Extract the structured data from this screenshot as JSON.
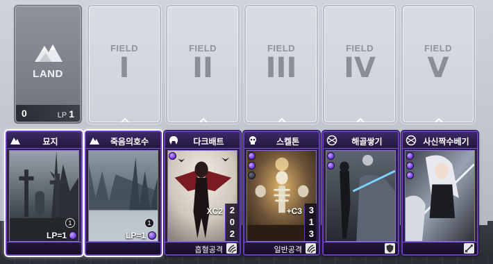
{
  "land": {
    "label": "LAND",
    "count": "0",
    "lp_label": "LP",
    "lp_value": "1"
  },
  "fields": [
    {
      "word": "FIELD",
      "numeral": "I"
    },
    {
      "word": "FIELD",
      "numeral": "II"
    },
    {
      "word": "FIELD",
      "numeral": "III"
    },
    {
      "word": "FIELD",
      "numeral": "IV"
    },
    {
      "word": "FIELD",
      "numeral": "V"
    }
  ],
  "cards": [
    {
      "name": "묘지",
      "cost": "1",
      "lp": "LP=1",
      "icon": "mountain-icon"
    },
    {
      "name": "죽음의호수",
      "cost": "1",
      "lp": "LP=1",
      "icon": "mountain-icon"
    },
    {
      "name": "다크배트",
      "multiplier": "XC2",
      "stats": [
        "2",
        "0",
        "2"
      ],
      "footer": "흡혈공격",
      "icon": "helmet-icon",
      "foot_icon": "claw-icon"
    },
    {
      "name": "스켈톤",
      "multiplier": "+C3",
      "stats": [
        "3",
        "1",
        "3"
      ],
      "footer": "일반공격",
      "icon": "skull-icon",
      "foot_icon": "claw-icon"
    },
    {
      "name": "해골쌓기",
      "icon": "rune-icon",
      "foot_icon": "shield-icon"
    },
    {
      "name": "사신짝수베기",
      "icon": "rune-icon",
      "foot_icon": "sword-icon"
    }
  ],
  "colors": {
    "card_border": "#6a3ec4",
    "gem": "#7b45e6",
    "board": "#c8ccd5"
  }
}
